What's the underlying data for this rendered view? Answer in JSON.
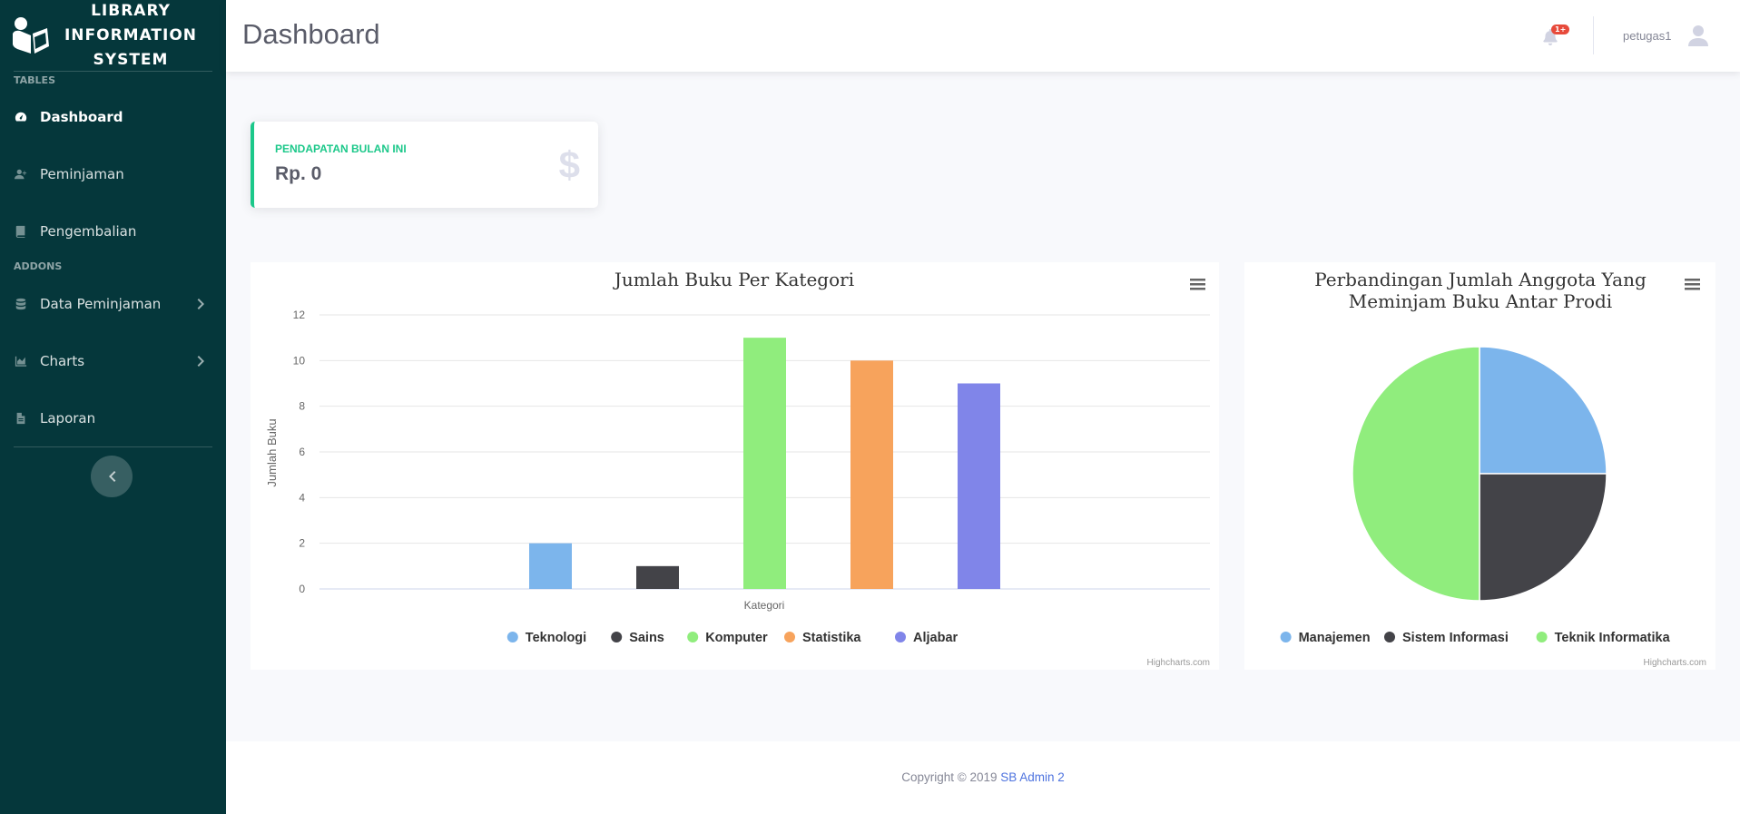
{
  "sidebar": {
    "brand": [
      "LIBRARY",
      "INFORMATION",
      "SYSTEM"
    ],
    "heading_tables": "TABLES",
    "heading_addons": "ADDONS",
    "items": [
      {
        "label": "Dashboard",
        "icon": "tachometer-icon",
        "active": true
      },
      {
        "label": "Peminjaman",
        "icon": "user-plus-icon"
      },
      {
        "label": "Pengembalian",
        "icon": "book-icon"
      },
      {
        "label": "Data Peminjaman",
        "icon": "database-icon",
        "has_submenu": true
      },
      {
        "label": "Charts",
        "icon": "chart-area-icon",
        "has_submenu": true
      },
      {
        "label": "Laporan",
        "icon": "file-icon"
      }
    ]
  },
  "topbar": {
    "title": "Dashboard",
    "notification_badge": "1+",
    "username": "petugas1"
  },
  "earnings_card": {
    "label": "PENDAPATAN BULAN INI",
    "value": "Rp. 0",
    "icon": "dollar-icon"
  },
  "footer": {
    "text": "Copyright © 2019 ",
    "link": "SB Admin 2"
  },
  "chart_data": [
    {
      "type": "bar",
      "title": "Jumlah Buku Per Kategori",
      "xlabel": "Kategori",
      "ylabel": "Jumlah Buku",
      "ylim": [
        0,
        12
      ],
      "yticks": [
        0,
        2,
        4,
        6,
        8,
        10,
        12
      ],
      "series": [
        {
          "name": "Teknologi",
          "value": 2,
          "color": "#7cb5ec"
        },
        {
          "name": "Sains",
          "value": 1,
          "color": "#434348"
        },
        {
          "name": "Komputer",
          "value": 11,
          "color": "#90ed7d"
        },
        {
          "name": "Statistika",
          "value": 10,
          "color": "#f7a35c"
        },
        {
          "name": "Aljabar",
          "value": 9,
          "color": "#8085e9"
        }
      ],
      "legend": "bottom",
      "credits": "Highcharts.com"
    },
    {
      "type": "pie",
      "title_lines": [
        "Perbandingan Jumlah Anggota Yang",
        "Meminjam Buku Antar Prodi"
      ],
      "slices": [
        {
          "name": "Manajemen",
          "value": 1,
          "color": "#7cb5ec"
        },
        {
          "name": "Sistem Informasi",
          "value": 1,
          "color": "#434348"
        },
        {
          "name": "Teknik Informatika",
          "value": 2,
          "color": "#90ed7d"
        }
      ],
      "legend": "bottom",
      "credits": "Highcharts.com"
    }
  ]
}
